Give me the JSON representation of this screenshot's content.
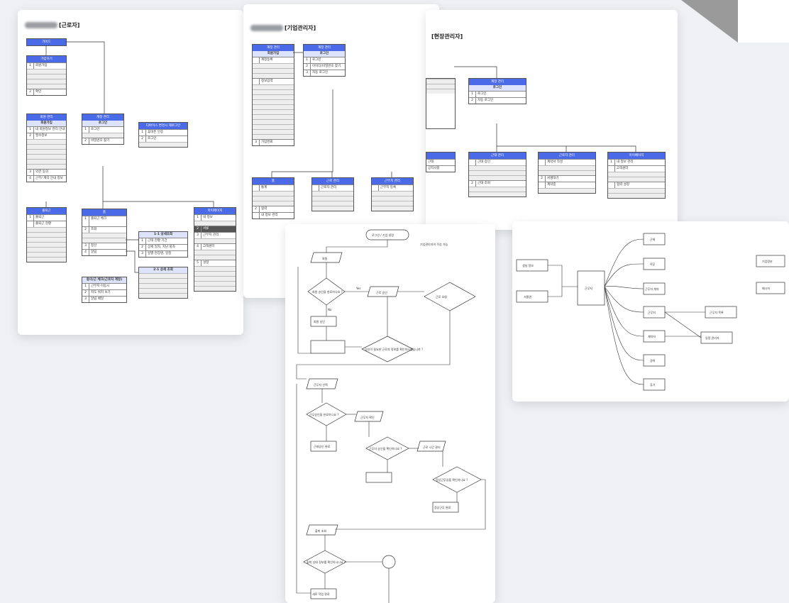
{
  "worker": {
    "title": "[근로자]",
    "blocks": [
      {
        "header": "가이드",
        "rows": []
      },
      {
        "header": "가입하기",
        "sub_header": "",
        "rows": [
          {
            "n": "1",
            "t": "회원가입"
          },
          {
            "n": "",
            "t": ""
          },
          {
            "n": "2",
            "t": "확인"
          }
        ]
      },
      {
        "header": "회원 관리",
        "sub_header": "회원가입",
        "rows": [
          {
            "n": "1",
            "t": "내 회원정보 관리 안내"
          },
          {
            "n": "",
            "t": "필수정보"
          },
          {
            "n": "2",
            "t": ""
          },
          {
            "n": "3",
            "t": "약관 동의"
          },
          {
            "n": "4",
            "t": "근무/ 계약 안내 정보"
          }
        ]
      },
      {
        "header": "계정 관리",
        "sub_header": "로그인",
        "rows": [
          {
            "n": "1",
            "t": "로그인"
          },
          {
            "n": "2",
            "t": "비밀번호 찾기"
          }
        ]
      },
      {
        "header": "디바이스 변경시 재로그인",
        "sub_header": "",
        "rows": [
          {
            "n": "1",
            "t": "휴대폰 인증"
          },
          {
            "n": "2",
            "t": "로그인"
          }
        ]
      },
      {
        "header": "출퇴근",
        "rows": [
          {
            "n": "1",
            "t": "출퇴근"
          },
          {
            "n": "",
            "t": "출퇴근 현황"
          },
          {
            "n": "2",
            "t": ""
          }
        ]
      },
      {
        "header": "홈",
        "rows": [
          {
            "n": "1",
            "t": "출퇴근 체크"
          },
          {
            "n": "2",
            "t": "조회"
          },
          {
            "n": "3",
            "t": "정산"
          },
          {
            "n": "4",
            "t": "알림"
          }
        ]
      },
      {
        "header": "1-1 상세조회",
        "rows": [
          {
            "n": "1",
            "t": "근태 현황 기간"
          },
          {
            "n": "2",
            "t": "상세 일자, 지난 회차"
          },
          {
            "n": "3",
            "t": "일별 현장명, 일정"
          }
        ]
      },
      {
        "header": "2-1 상세 조회",
        "rows": []
      },
      {
        "header": "동의/근 체크(근로자 계정)",
        "rows": [
          {
            "n": "1",
            "t": "근무지 이동시"
          },
          {
            "n": "2",
            "t": "지도 위치 보기"
          },
          {
            "n": "3",
            "t": "알림 배달"
          }
        ]
      },
      {
        "header": "마이페이지",
        "rows": [
          {
            "n": "1",
            "t": "내 정보"
          },
          {
            "n": "2",
            "t": "서류"
          },
          {
            "n": "3",
            "t": "근무지 관리"
          },
          {
            "n": "4",
            "t": "고객센터"
          },
          {
            "n": "5",
            "t": "설정"
          }
        ]
      }
    ]
  },
  "company": {
    "title": "[기업관리자]",
    "blocks": [
      {
        "header": "계정 관리",
        "sub_header": "회원가입",
        "rows": [
          {
            "n": "1",
            "t": "계정등록"
          },
          {
            "n": "2",
            "t": "정보입력"
          },
          {
            "n": "3",
            "t": "가입완료"
          }
        ]
      },
      {
        "header": "계정 관리",
        "sub_header": "로그인",
        "rows": [
          {
            "n": "1",
            "t": "로그인"
          },
          {
            "n": "2",
            "t": "아이디/비밀번호 찾기"
          },
          {
            "n": "3",
            "t": "자동 로그인"
          }
        ]
      },
      {
        "header": "홈",
        "rows": [
          {
            "n": "",
            "t": "통계"
          },
          {
            "n": "1",
            "t": ""
          },
          {
            "n": "2",
            "t": "협력"
          },
          {
            "n": "3",
            "t": "내 정보 관리"
          }
        ]
      },
      {
        "header": "근로 관리",
        "rows": [
          {
            "n": "",
            "t": "근로자 관리"
          }
        ]
      },
      {
        "header": "근무지 관리",
        "rows": [
          {
            "n": "",
            "t": "근무지 등록"
          }
        ]
      }
    ]
  },
  "site": {
    "title": "[현장관리자]",
    "blocks": [
      {
        "header": "계정 관리",
        "sub_header": "로그인",
        "rows": [
          {
            "n": "1",
            "t": "로그인"
          },
          {
            "n": "2",
            "t": "자동 로그인"
          }
        ]
      },
      {
        "header": "근태 관리",
        "rows": [
          {
            "n": "",
            "t": "근태 승인"
          },
          {
            "n": "1",
            "t": ""
          },
          {
            "n": "2",
            "t": "근태 조회"
          }
        ]
      },
      {
        "header": "근로자 관리",
        "rows": [
          {
            "n": "",
            "t": "계약서 작성"
          },
          {
            "n": "1",
            "t": ""
          },
          {
            "n": "2",
            "t": "서명대기"
          },
          {
            "n": "",
            "t": "계약중"
          },
          {
            "n": "3",
            "t": ""
          }
        ]
      },
      {
        "header": "마이페이지",
        "rows": [
          {
            "n": "1",
            "t": "내 정보 관리"
          },
          {
            "n": "",
            "t": "고객센터"
          },
          {
            "n": "2",
            "t": ""
          },
          {
            "n": "",
            "t": "협력 설정"
          },
          {
            "n": "3",
            "t": ""
          }
        ]
      },
      {
        "header": "",
        "rows": [
          {
            "n": "",
            "t": "근태"
          },
          {
            "n": "",
            "t": "공지사항"
          }
        ]
      }
    ]
  },
  "flowchart": {
    "title": "기업관리자의 작성 가능",
    "start": "로그인 / 기업 설정",
    "nodes": [
      "회원",
      "회원 승인을 완료하나요 ?",
      "근로 승인",
      "근로 요청",
      "회원 승인",
      "승인이 필요한 근로자 정보를 확인하시겠습니까 ?",
      "근무지 선택",
      "근무승인을 완료하나요 ?",
      "근무지 확인",
      "근무자 승인을 확인하나요 ?",
      "근태승인 완료",
      "근로 시간 관리",
      "정상근무임을 확인하나요 ?",
      "정상근무 완료",
      "출퇴 조회",
      "출퇴 상태 정보를 확인하시나요 ?",
      "새로 작업 완료"
    ],
    "labels": {
      "yes": "Yes",
      "no": "No"
    }
  },
  "network": {
    "left": [
      "생일 정보",
      "서울권"
    ],
    "center": "근무지",
    "right": [
      "근태",
      "직무",
      "근무자 계약",
      "근무지",
      "계약서",
      "경력",
      "휴가"
    ],
    "far_right": [
      "근무자 목록",
      "일정 관리자"
    ],
    "extra": [
      "기업정보",
      "메시지"
    ]
  }
}
